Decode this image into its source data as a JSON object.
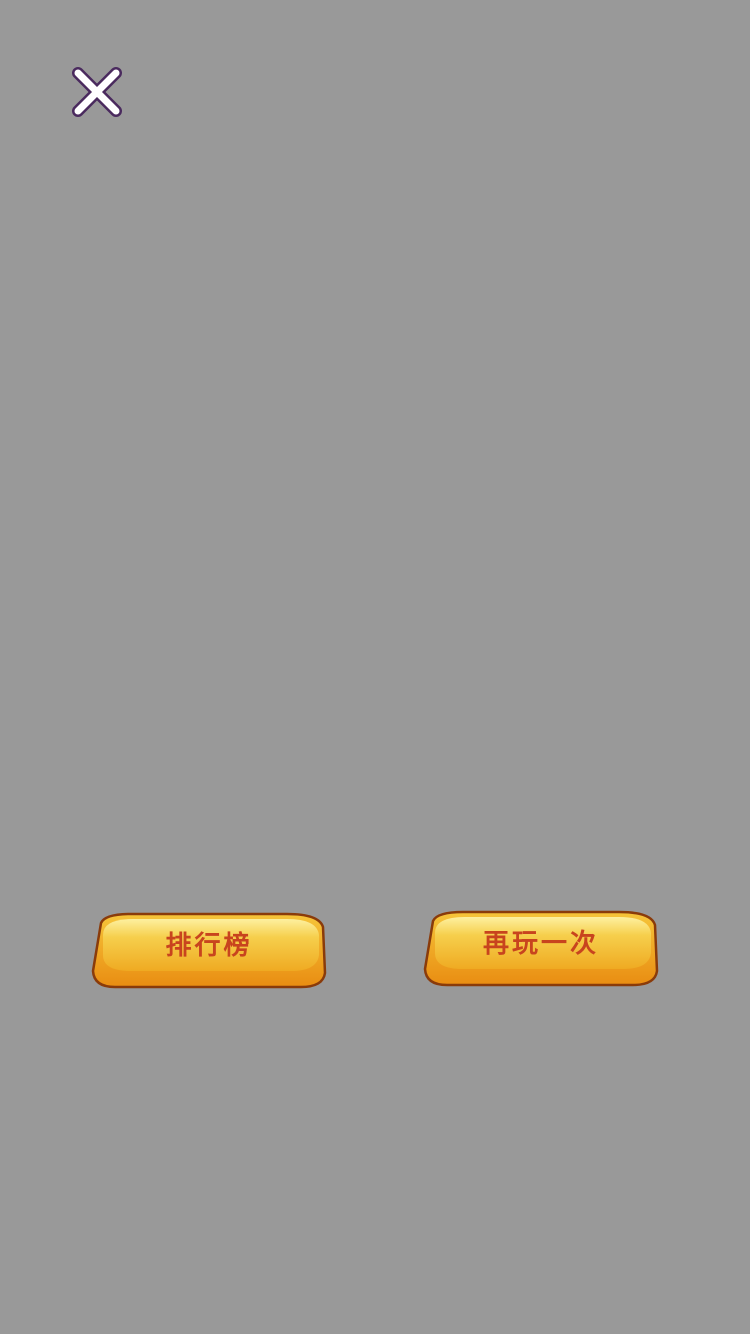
{
  "close_button": {
    "icon": "close-icon",
    "color": "#ffffff",
    "outline": "#4a2a5e"
  },
  "buttons": {
    "leaderboard_label": "排行榜",
    "play_again_label": "再玩一次"
  },
  "colors": {
    "background": "#999999",
    "button_fill": "#f0b21c",
    "button_outline": "#8a3b0a",
    "button_text": "#c8441e"
  }
}
